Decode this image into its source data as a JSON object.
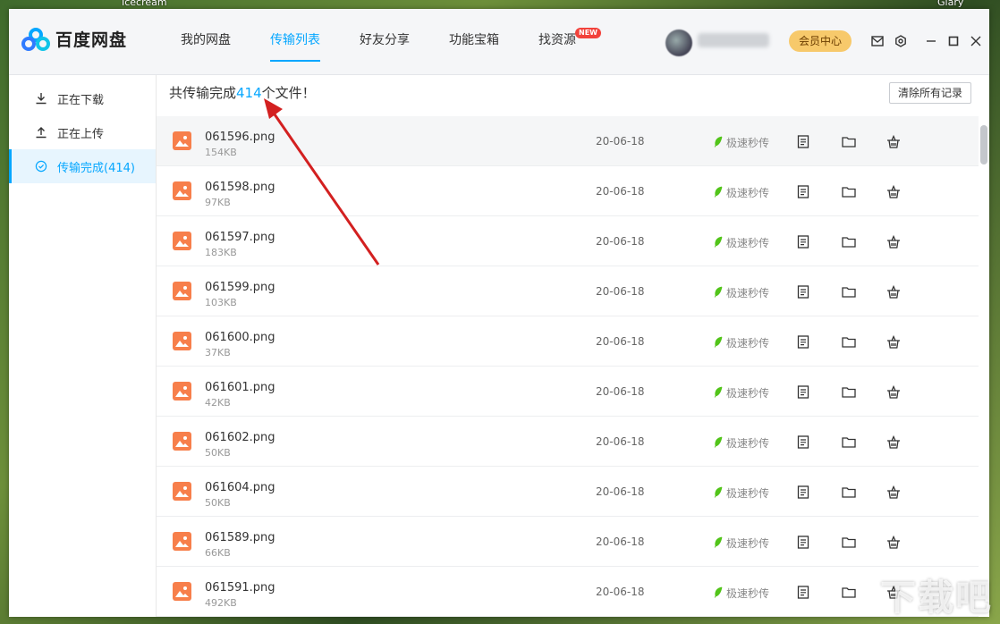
{
  "desktop": {
    "left_label": "Icecream",
    "right_label": "Glary",
    "watermark": "下载吧"
  },
  "app": {
    "name": "百度网盘",
    "nav": [
      {
        "label": "我的网盘"
      },
      {
        "label": "传输列表",
        "active": true
      },
      {
        "label": "好友分享"
      },
      {
        "label": "功能宝箱"
      },
      {
        "label": "找资源",
        "badge": "NEW"
      }
    ],
    "vip_button": "会员中心",
    "window_buttons": [
      "mail-icon",
      "settings-icon",
      "minimize-icon",
      "maximize-icon",
      "close-icon"
    ]
  },
  "sidebar": {
    "items": [
      {
        "label": "正在下载",
        "icon": "download-icon"
      },
      {
        "label": "正在上传",
        "icon": "upload-icon"
      },
      {
        "label": "传输完成(414)",
        "icon": "check-circle-icon",
        "active": true
      }
    ]
  },
  "main": {
    "summary_prefix": "共传输完成",
    "summary_count": "414",
    "summary_suffix": "个文件！",
    "clear_button": "清除所有记录",
    "fast_label": "极速秒传",
    "files": [
      {
        "name": "061596.png",
        "size": "154KB",
        "date": "20-06-18"
      },
      {
        "name": "061598.png",
        "size": "97KB",
        "date": "20-06-18"
      },
      {
        "name": "061597.png",
        "size": "183KB",
        "date": "20-06-18"
      },
      {
        "name": "061599.png",
        "size": "103KB",
        "date": "20-06-18"
      },
      {
        "name": "061600.png",
        "size": "37KB",
        "date": "20-06-18"
      },
      {
        "name": "061601.png",
        "size": "42KB",
        "date": "20-06-18"
      },
      {
        "name": "061602.png",
        "size": "50KB",
        "date": "20-06-18"
      },
      {
        "name": "061604.png",
        "size": "50KB",
        "date": "20-06-18"
      },
      {
        "name": "061589.png",
        "size": "66KB",
        "date": "20-06-18"
      },
      {
        "name": "061591.png",
        "size": "492KB",
        "date": "20-06-18"
      }
    ]
  },
  "colors": {
    "accent": "#06a7ff",
    "file_icon": "#f77f4b",
    "fast_green": "#52c41a",
    "arrow": "#d32020"
  }
}
